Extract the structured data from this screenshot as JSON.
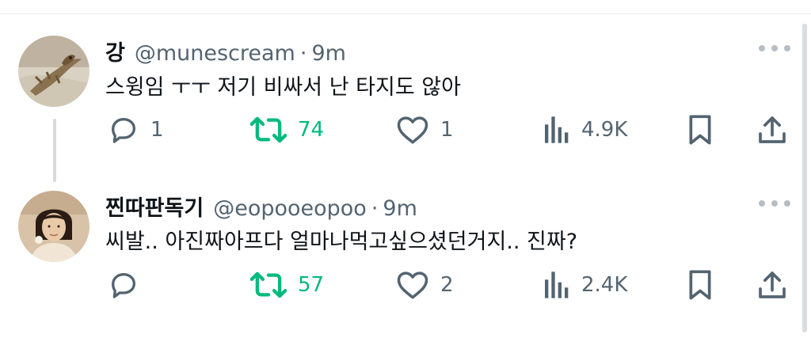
{
  "tweets": [
    {
      "display_name": "강",
      "handle": "@munescream",
      "separator": "·",
      "time": "9m",
      "text": "스윙임 ㅜㅜ 저기 비싸서 난 타지도 않아",
      "replies": "1",
      "retweets": "74",
      "likes": "1",
      "views": "4.9K",
      "avatar_icon": "lizard-photo"
    },
    {
      "display_name": "찐따판독기",
      "handle": "@eopooeopoo",
      "separator": "·",
      "time": "9m",
      "text": "씨발.. 아진짜아프다 얼마나먹고싶으셨던거지.. 진짜?",
      "replies": "",
      "retweets": "57",
      "likes": "2",
      "views": "2.4K",
      "avatar_icon": "person-photo"
    }
  ],
  "colors": {
    "text": "#0f1419",
    "secondary": "#536471",
    "retweet_green": "#00ba7c",
    "divider": "#e6e9ec"
  }
}
